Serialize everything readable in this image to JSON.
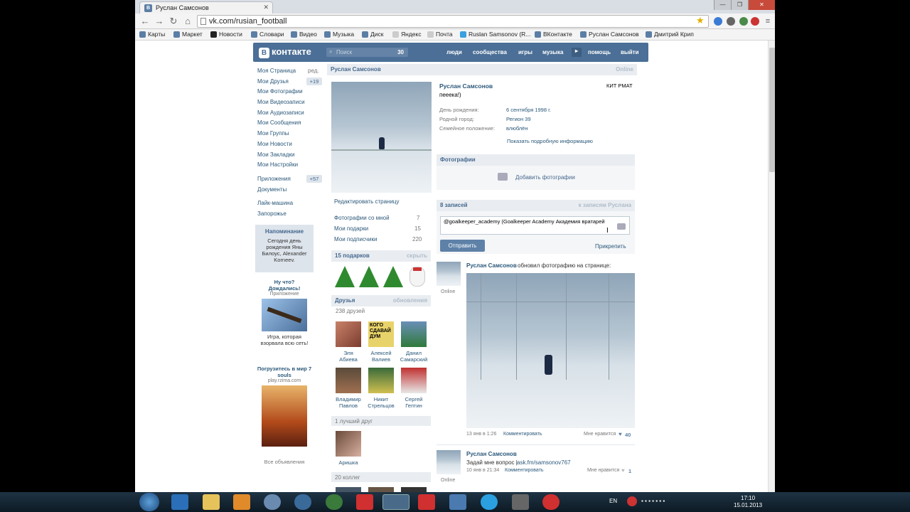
{
  "browser": {
    "tab_title": "Руслан Самсонов",
    "url": "vk.com/rusian_football",
    "bookmarks": [
      "Карты",
      "Маркет",
      "Новости",
      "Словари",
      "Видео",
      "Музыка",
      "Диск",
      "Яндекс",
      "Почта",
      "Ruslan Samsonov (R...",
      "ВКонтакте",
      "Руслан Самсонов",
      "Дмитрий Крип"
    ]
  },
  "vk": {
    "logo": "контакте",
    "logo_letter": "В",
    "search_placeholder": "Поиск",
    "search_count": "30",
    "nav": [
      "люди",
      "сообщества",
      "игры",
      "музыка",
      "помощь",
      "выйти"
    ]
  },
  "left_menu": {
    "items": [
      "Моя Страница",
      "Мои Друзья",
      "Мои Фотографии",
      "Мои Видеозаписи",
      "Мои Аудиозаписи",
      "Мои Сообщения",
      "Мои Группы",
      "Мои Новости",
      "Мои Закладки",
      "Мои Настройки",
      "Приложения",
      "Документы",
      "Лайк-машина",
      "Запорожье"
    ],
    "edit": "ред.",
    "friends_count": "+19",
    "apps_count": "+57",
    "reminder": {
      "title": "Напоминание",
      "text": "Сегодня день рождения Яны Билоус, Alexander Korneev."
    },
    "ad1": {
      "title": "Ну что? Дождались!",
      "sub": "Приложение",
      "text": "Игра, которая взорвала всю сеть!"
    },
    "ad2": {
      "title": "Погрузитесь в мир 7 souls",
      "sub": "play.rzima.com"
    },
    "all_ads": "Все объявления"
  },
  "profile": {
    "header_name": "Руслан Самсонов",
    "header_status": "Online",
    "name": "Руслан Самсонов",
    "status": "пееека!)",
    "school": "КИТ РМАТ",
    "info": [
      {
        "label": "День рождения:",
        "value": "6 сентября 1998 г."
      },
      {
        "label": "Родной город:",
        "value": "Регион 39"
      },
      {
        "label": "Семейное положение:",
        "value": "влюблён"
      }
    ],
    "more_info": "Показать подробную информацию",
    "edit_page": "Редактировать страницу",
    "counters": [
      {
        "label": "Фотографии со мной",
        "value": "7"
      },
      {
        "label": "Мои подарки",
        "value": "15"
      },
      {
        "label": "Мои подписчики",
        "value": "220"
      }
    ],
    "gifts_title": "15 подарков",
    "gifts_hide": "скрыть",
    "friends_title": "Друзья",
    "friends_updates": "обновления",
    "friends_count": "238 друзей",
    "friends": [
      {
        "first": "Эля",
        "last": "Абиева"
      },
      {
        "first": "Алексей",
        "last": "Валиев"
      },
      {
        "first": "Данил",
        "last": "Самарский"
      },
      {
        "first": "Владимир",
        "last": "Павлов"
      },
      {
        "first": "Никит",
        "last": "Стрельцов"
      },
      {
        "first": "Сергей",
        "last": "Гептин"
      }
    ],
    "best_friend_title": "1 лучший друг",
    "best_friend": "Аришка",
    "colleagues": "20 коллег",
    "sign_no_text": "КОГО СДАВАЙ ДУМ"
  },
  "photos_block": {
    "title": "Фотографии",
    "add": "Добавить фотографии"
  },
  "wall": {
    "count": "8 записей",
    "to_posts": "к записям Руслана",
    "input_value": "@goalkeeper_academy  (Goalkeeper Academy Академия вратарей",
    "send": "Отправить",
    "attach": "Прикрепить",
    "posts": [
      {
        "author": "Руслан Самсонов",
        "action": "обновил фотографию на странице:",
        "online": "Online",
        "date": "13 янв в 1:26",
        "comment": "Комментировать",
        "likes_label": "Мне нравится",
        "likes": "40"
      },
      {
        "author": "Руслан Самсонов",
        "text": "Задай мне вопрос |",
        "link": "ask.fm/samsonov767",
        "online": "Online",
        "date": "10 янв в 21:34",
        "comment": "Комментировать",
        "likes_label": "Мне нравится",
        "likes": "1"
      }
    ]
  },
  "taskbar": {
    "lang": "EN",
    "time": "17:10",
    "date": "15.01.2013"
  }
}
